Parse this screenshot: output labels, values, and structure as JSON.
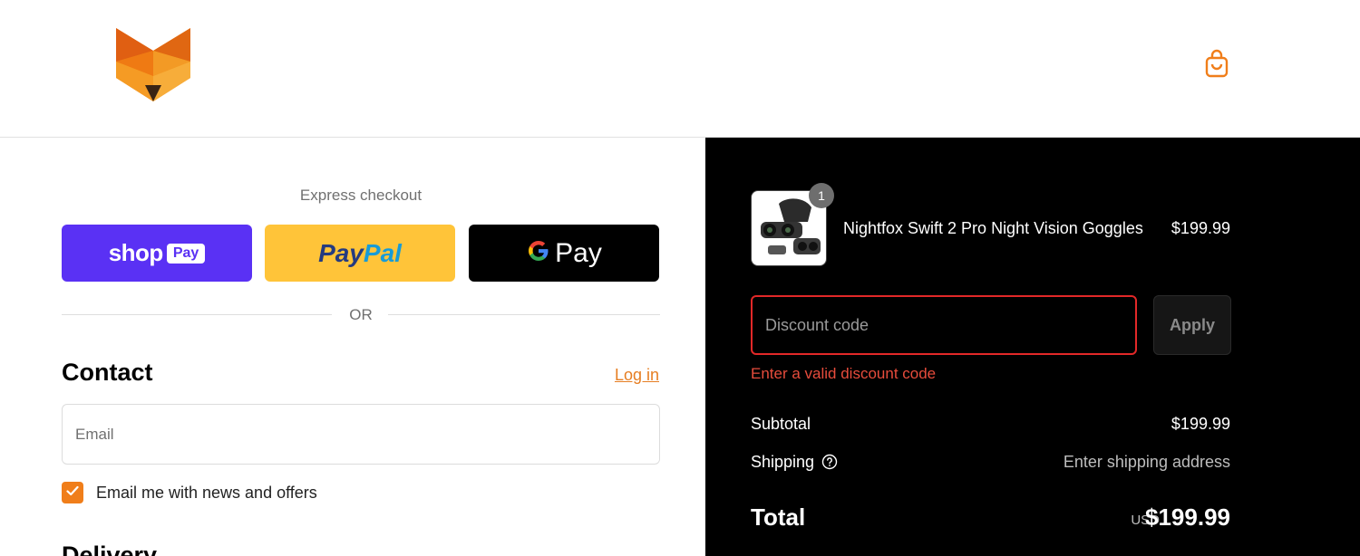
{
  "header": {
    "logo": "fox-logo",
    "cart_icon": "shopping-bag-icon",
    "accent_color": "#f07e1a"
  },
  "express_checkout": {
    "label": "Express checkout",
    "shop_pay": {
      "shop": "shop",
      "pay": "Pay",
      "color": "#5a31f4"
    },
    "paypal": {
      "pay": "Pay",
      "pal": "Pal",
      "color": "#ffc439"
    },
    "google_pay": {
      "label": "Pay",
      "color": "#000000"
    },
    "or": "OR"
  },
  "contact": {
    "title": "Contact",
    "login": "Log in",
    "email_placeholder": "Email",
    "newsletter_label": "Email me with news and offers",
    "newsletter_checked": true
  },
  "delivery": {
    "title": "Delivery"
  },
  "order_summary": {
    "product": {
      "name": "Nightfox Swift 2 Pro Night Vision Goggles",
      "price": "$199.99",
      "quantity": "1"
    },
    "discount": {
      "placeholder": "Discount code",
      "apply": "Apply",
      "error": "Enter a valid discount code"
    },
    "subtotal_label": "Subtotal",
    "subtotal_value": "$199.99",
    "shipping_label": "Shipping",
    "shipping_value": "Enter shipping address",
    "total_label": "Total",
    "total_currency": "USD",
    "total_value": "$199.99"
  }
}
